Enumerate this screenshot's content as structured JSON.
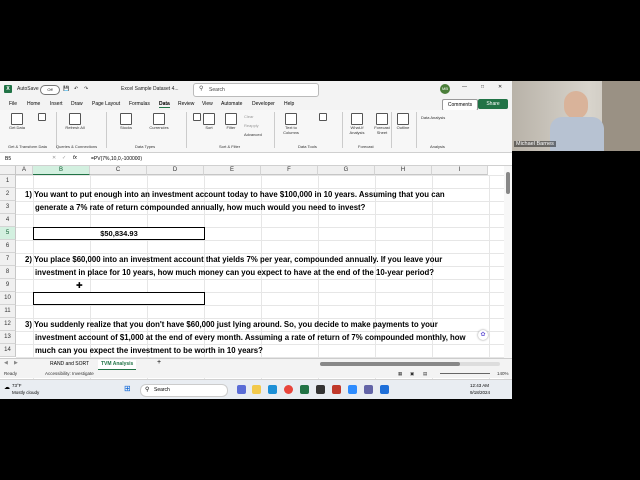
{
  "window": {
    "autosave_label": "AutoSave",
    "autosave_state": "Off",
    "file_title": "Excel Sample Dataset 4...",
    "search_placeholder": "Search",
    "user_initials": "MB"
  },
  "menu": {
    "tabs": [
      "File",
      "Home",
      "Insert",
      "Draw",
      "Page Layout",
      "Formulas",
      "Data",
      "Review",
      "View",
      "Automate",
      "Developer",
      "Help"
    ],
    "active": "Data",
    "comments_label": "Comments",
    "share_label": "Share"
  },
  "ribbon": {
    "get_data": "Get Data",
    "refresh_all": "Refresh All",
    "stocks": "Stocks",
    "currencies": "Currencies",
    "sort": "Sort",
    "filter": "Filter",
    "clear": "Clear",
    "reapply": "Reapply",
    "advanced": "Advanced",
    "text_to_columns": "Text to Columns",
    "what_if": "What-If Analysis",
    "forecast_sheet": "Forecast Sheet",
    "outline": "Outline",
    "data_analysis": "Data Analysis",
    "groups": [
      "Get & Transform Data",
      "Queries & Connections",
      "Data Types",
      "Sort & Filter",
      "Data Tools",
      "Forecast",
      "Analysis"
    ]
  },
  "formula_bar": {
    "name_box": "B5",
    "fx": "fx",
    "formula": "=PV(7%,10,0,-100000)"
  },
  "grid": {
    "columns": [
      "A",
      "B",
      "C",
      "D",
      "E",
      "F",
      "G",
      "H",
      "I"
    ],
    "rows": [
      "1",
      "2",
      "3",
      "4",
      "5",
      "6",
      "7",
      "8",
      "9",
      "10",
      "11",
      "12",
      "13",
      "14"
    ],
    "selected_column": "B",
    "selected_row": "5"
  },
  "cells": {
    "q1_line1": "1) You want to put enough into an investment account today to have $100,000 in 10 years.  Assuming that you can",
    "q1_line2": "generate a 7% rate of return compounded annually, how much would you need to invest?",
    "b5_value": "$50,834.93",
    "q2_line1": "2) You place $60,000 into an investment account that yields 7% per year, compounded annually.  If you leave your",
    "q2_line2": "investment in place for 10 years, how much money can you expect to have at the end of the 10-year period?",
    "q3_line1": "3) You suddenly realize that you don't have $60,000 just lying around.  So, you decide to make payments to your",
    "q3_line2": "investment account of $1,000 at the end of every month.  Assuming a rate of return of 7% compounded monthly, how",
    "q3_line3": "much can you expect the investment to be worth in 10 years?"
  },
  "sheets": {
    "tabs": [
      "RAND and SORT",
      "TVM Analysis"
    ],
    "active": "TVM Analysis",
    "add": "+"
  },
  "status": {
    "ready": "Ready",
    "accessibility": "Accessibility: Investigate",
    "zoom": "140%"
  },
  "taskbar": {
    "weather_temp": "73°F",
    "weather_desc": "Mostly cloudy",
    "search": "Search",
    "time": "12:43 AM",
    "date": "9/18/2024"
  },
  "webcam": {
    "name": "Michael Barnes"
  }
}
